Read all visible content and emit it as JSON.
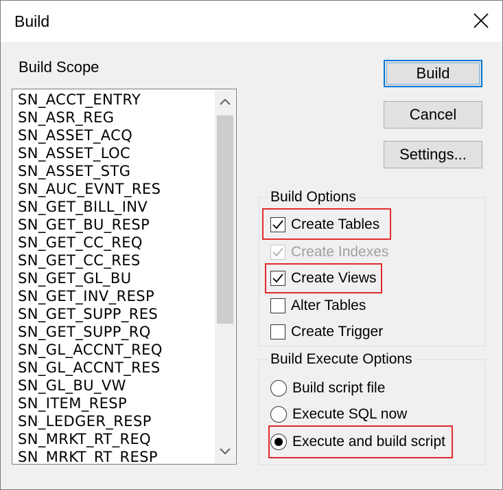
{
  "window": {
    "title": "Build",
    "close_icon": "close-icon"
  },
  "scope": {
    "label": "Build Scope",
    "items": [
      "SN_ACCT_ENTRY",
      "SN_ASR_REG",
      "SN_ASSET_ACQ",
      "SN_ASSET_LOC",
      "SN_ASSET_STG",
      "SN_AUC_EVNT_RES",
      "SN_GET_BILL_INV",
      "SN_GET_BU_RESP",
      "SN_GET_CC_REQ",
      "SN_GET_CC_RES",
      "SN_GET_GL_BU",
      "SN_GET_INV_RESP",
      "SN_GET_SUPP_RES",
      "SN_GET_SUPP_RQ",
      "SN_GL_ACCNT_REQ",
      "SN_GL_ACCNT_RES",
      "SN_GL_BU_VW",
      "SN_ITEM_RESP",
      "SN_LEDGER_RESP",
      "SN_MRKT_RT_REQ",
      "SN_MRKT_RT_RESP"
    ]
  },
  "buttons": {
    "build": "Build",
    "cancel": "Cancel",
    "settings": "Settings..."
  },
  "build_options": {
    "label": "Build Options",
    "create_tables": {
      "label": "Create Tables",
      "checked": true
    },
    "create_indexes": {
      "label": "Create Indexes",
      "checked": true,
      "disabled": true
    },
    "create_views": {
      "label": "Create Views",
      "checked": true
    },
    "alter_tables": {
      "label": "Alter Tables",
      "checked": false
    },
    "create_trigger": {
      "label": "Create Trigger",
      "checked": false
    }
  },
  "execute_options": {
    "label": "Build Execute Options",
    "build_script_file": {
      "label": "Build script file",
      "selected": false
    },
    "execute_sql_now": {
      "label": "Execute SQL now",
      "selected": false
    },
    "execute_and_build": {
      "label": "Execute and build script",
      "selected": true
    }
  },
  "colors": {
    "highlight": "#e02a2a",
    "default_button_border": "#0078d7"
  }
}
